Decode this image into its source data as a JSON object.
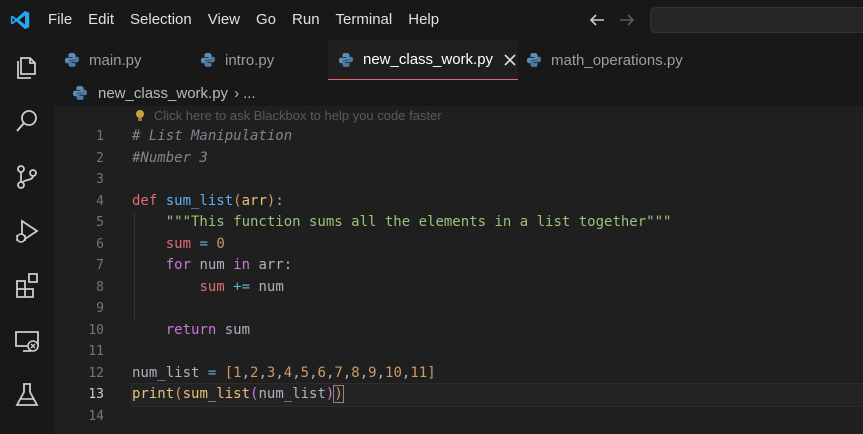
{
  "menu": {
    "items": [
      "File",
      "Edit",
      "Selection",
      "View",
      "Go",
      "Run",
      "Terminal",
      "Help"
    ]
  },
  "icons": {
    "logo": "vscode-logo-icon",
    "back": "arrow-left-icon",
    "forward": "arrow-right-icon",
    "activity": [
      "explorer-icon",
      "search-icon",
      "source-control-icon",
      "run-debug-icon",
      "extensions-icon",
      "remote-explorer-icon",
      "testing-icon"
    ]
  },
  "tabs": [
    {
      "label": "main.py",
      "active": false
    },
    {
      "label": "intro.py",
      "active": false
    },
    {
      "label": "new_class_work.py",
      "active": true
    },
    {
      "label": "math_operations.py",
      "active": false
    }
  ],
  "breadcrumb": {
    "file": "new_class_work.py",
    "separator": "›",
    "more": "..."
  },
  "editor": {
    "hint": "Click here to ask Blackbox to help you code faster",
    "current_line": 13,
    "line_numbers": [
      "1",
      "2",
      "3",
      "4",
      "5",
      "6",
      "7",
      "8",
      "9",
      "10",
      "11",
      "12",
      "13",
      "14"
    ]
  },
  "colors": {
    "background": "#1f1f1f",
    "chrome": "#181818",
    "active_tab_border": "#e06c75",
    "vscode_blue": "#23a9f2"
  }
}
